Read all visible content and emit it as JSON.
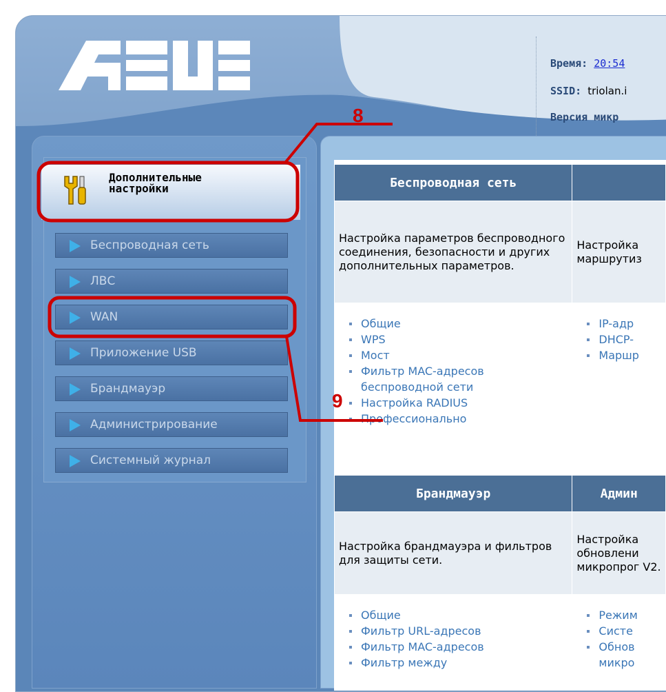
{
  "header": {
    "brand": "ASUS",
    "time_label": "Время:",
    "time_value": "20:54",
    "ssid_label": "SSID:",
    "ssid_value": "triolan.i",
    "firmware_label": "Версия микр"
  },
  "sidebar": {
    "advanced_label_line1": "Дополнительные",
    "advanced_label_line2": "настройки",
    "items": [
      {
        "label": "Беспроводная сеть"
      },
      {
        "label": "ЛВС"
      },
      {
        "label": "WAN"
      },
      {
        "label": "Приложение USB"
      },
      {
        "label": "Брандмауэр"
      },
      {
        "label": "Администрирование"
      },
      {
        "label": "Системный журнал"
      }
    ]
  },
  "sections": {
    "wireless": {
      "title": "Беспроводная сеть",
      "description": "Настройка параметров беспроводного соединения, безопасности и других дополнительных параметров.",
      "links": [
        "Общие",
        "WPS",
        "Мост",
        "Фильтр MAC-адресов беспроводной сети",
        "Настройка RADIUS",
        "Профессионально"
      ]
    },
    "lan": {
      "title": "",
      "description": "Настройка маршрутиз",
      "links": [
        "IP-адр",
        "DHCP-",
        "Маршр"
      ]
    },
    "firewall": {
      "title": "Брандмауэр",
      "description": "Настройка брандмауэра и фильтров для защиты сети.",
      "links": [
        "Общие",
        "Фильтр URL-адресов",
        "Фильтр MAC-адресов",
        "Фильтр между"
      ]
    },
    "admin": {
      "title": "Админ",
      "description": "Настройка обновлени микропрог V2.",
      "links": [
        "Режим",
        "Систе",
        "Обнов микро"
      ]
    }
  },
  "annotations": {
    "step8": "8",
    "step9": "9",
    "color": "#cc0000"
  },
  "colors": {
    "frame_blue": "#5b86b8",
    "table_header": "#4b6f96",
    "link_blue": "#3a76b6"
  }
}
